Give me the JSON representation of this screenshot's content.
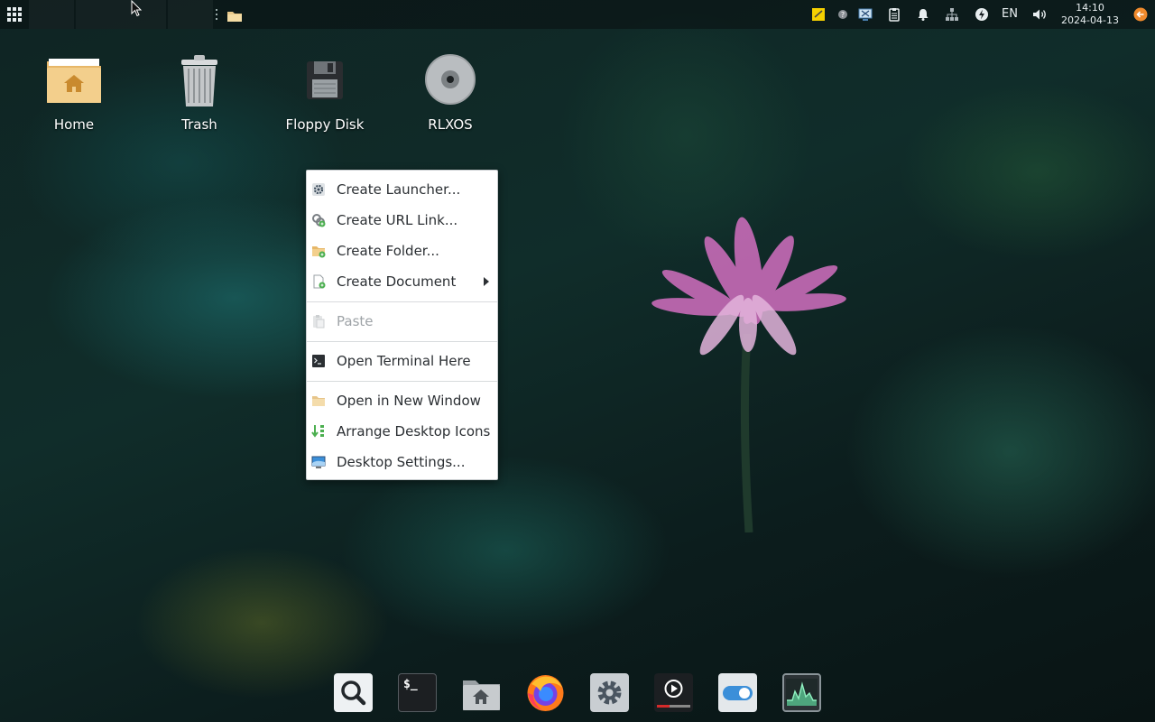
{
  "top_panel": {
    "apps_icon": "grid-apps-icon",
    "task_folder_icon": "folder-icon",
    "tray": {
      "items": [
        "sticky-notes-icon",
        "help-icon",
        "screenshot-icon",
        "clipboard-icon",
        "notifications-bell-icon",
        "network-icon",
        "power-manager-icon",
        "keyboard-layout",
        "volume-icon"
      ],
      "keyboard_layout": "EN",
      "clock_time": "14:10",
      "clock_date": "2024-04-13",
      "session_icon": "logout-icon"
    }
  },
  "desktop": {
    "icons": [
      {
        "label": "Home",
        "icon": "home-folder-icon"
      },
      {
        "label": "Trash",
        "icon": "trash-icon"
      },
      {
        "label": "Floppy Disk",
        "icon": "floppy-disk-icon"
      },
      {
        "label": "RLXOS",
        "icon": "optical-disc-icon"
      }
    ]
  },
  "context_menu": {
    "items": [
      {
        "label": "Create Launcher...",
        "icon": "gear-icon"
      },
      {
        "label": "Create URL Link...",
        "icon": "link-icon"
      },
      {
        "label": "Create Folder...",
        "icon": "new-folder-icon"
      },
      {
        "label": "Create Document",
        "icon": "new-document-icon",
        "submenu": true
      },
      {
        "label": "Paste",
        "icon": "paste-icon",
        "disabled": true
      },
      {
        "label": "Open Terminal Here",
        "icon": "terminal-icon"
      },
      {
        "label": "Open in New Window",
        "icon": "folder-icon"
      },
      {
        "label": "Arrange Desktop Icons",
        "icon": "arrange-icon"
      },
      {
        "label": "Desktop Settings...",
        "icon": "desktop-settings-icon"
      }
    ]
  },
  "dock": {
    "items": [
      "search-icon",
      "terminal-icon",
      "file-manager-icon",
      "firefox-icon",
      "settings-icon",
      "media-player-icon",
      "toggle-switch-icon",
      "system-monitor-icon"
    ],
    "terminal_glyph": "$_"
  },
  "colors": {
    "menu_bg": "#ffffff",
    "menu_text": "#2b2f33",
    "menu_disabled_text": "#9ea3a7",
    "panel_text": "#e8eef0"
  }
}
